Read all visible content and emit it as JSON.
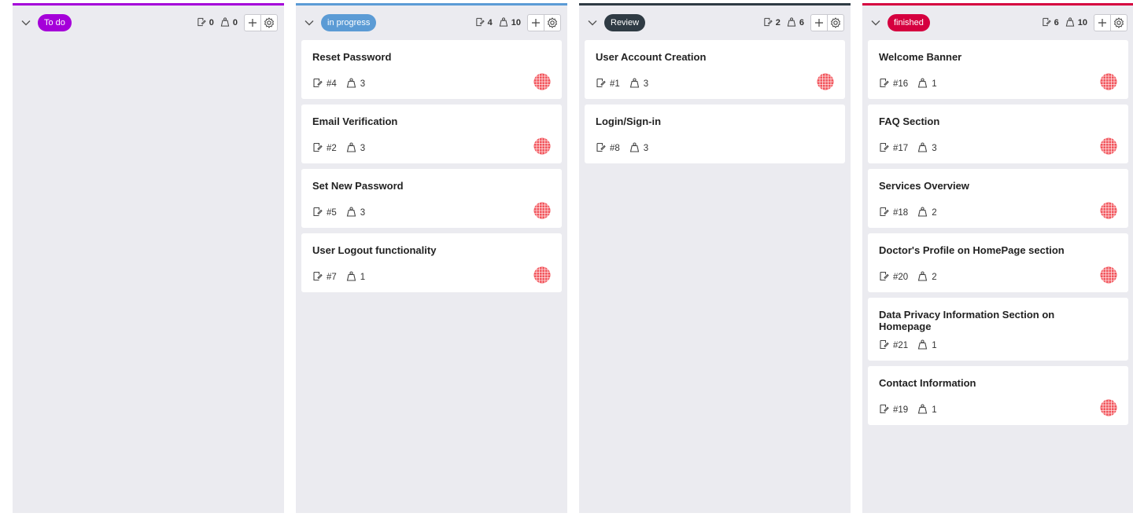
{
  "columns": [
    {
      "status": "To do",
      "accent": "#a500d9",
      "issue_count": "0",
      "points": "0",
      "cards": []
    },
    {
      "status": "in progress",
      "accent": "#5b9bd5",
      "issue_count": "4",
      "points": "10",
      "cards": [
        {
          "title": "Reset Password",
          "ref": "#4",
          "points": "3",
          "has_avatar": true
        },
        {
          "title": "Email Verification",
          "ref": "#2",
          "points": "3",
          "has_avatar": true
        },
        {
          "title": "Set New Password",
          "ref": "#5",
          "points": "3",
          "has_avatar": true
        },
        {
          "title": "User Logout functionality",
          "ref": "#7",
          "points": "1",
          "has_avatar": true
        }
      ]
    },
    {
      "status": "Review",
      "accent": "#2f3b44",
      "issue_count": "2",
      "points": "6",
      "cards": [
        {
          "title": "User Account Creation",
          "ref": "#1",
          "points": "3",
          "has_avatar": true
        },
        {
          "title": "Login/Sign-in",
          "ref": "#8",
          "points": "3",
          "has_avatar": false
        }
      ]
    },
    {
      "status": "finished",
      "accent": "#d5003f",
      "issue_count": "6",
      "points": "10",
      "cards": [
        {
          "title": "Welcome Banner",
          "ref": "#16",
          "points": "1",
          "has_avatar": true
        },
        {
          "title": "FAQ Section",
          "ref": "#17",
          "points": "3",
          "has_avatar": true
        },
        {
          "title": "Services Overview",
          "ref": "#18",
          "points": "2",
          "has_avatar": true
        },
        {
          "title": "Doctor's Profile on HomePage section",
          "ref": "#20",
          "points": "2",
          "has_avatar": true
        },
        {
          "title": "Data Privacy Information Section on Homepage",
          "ref": "#21",
          "points": "1",
          "has_avatar": false
        },
        {
          "title": "Contact Information",
          "ref": "#19",
          "points": "1",
          "has_avatar": true
        }
      ]
    }
  ],
  "icons": {
    "collapse": "chevron-down-icon",
    "issues": "issue-icon",
    "points": "weight-icon",
    "add": "plus-icon",
    "settings": "gear-icon",
    "avatar": "avatar"
  },
  "colors": {
    "column_bg": "#ebebf0",
    "avatar": "#f2545b"
  }
}
